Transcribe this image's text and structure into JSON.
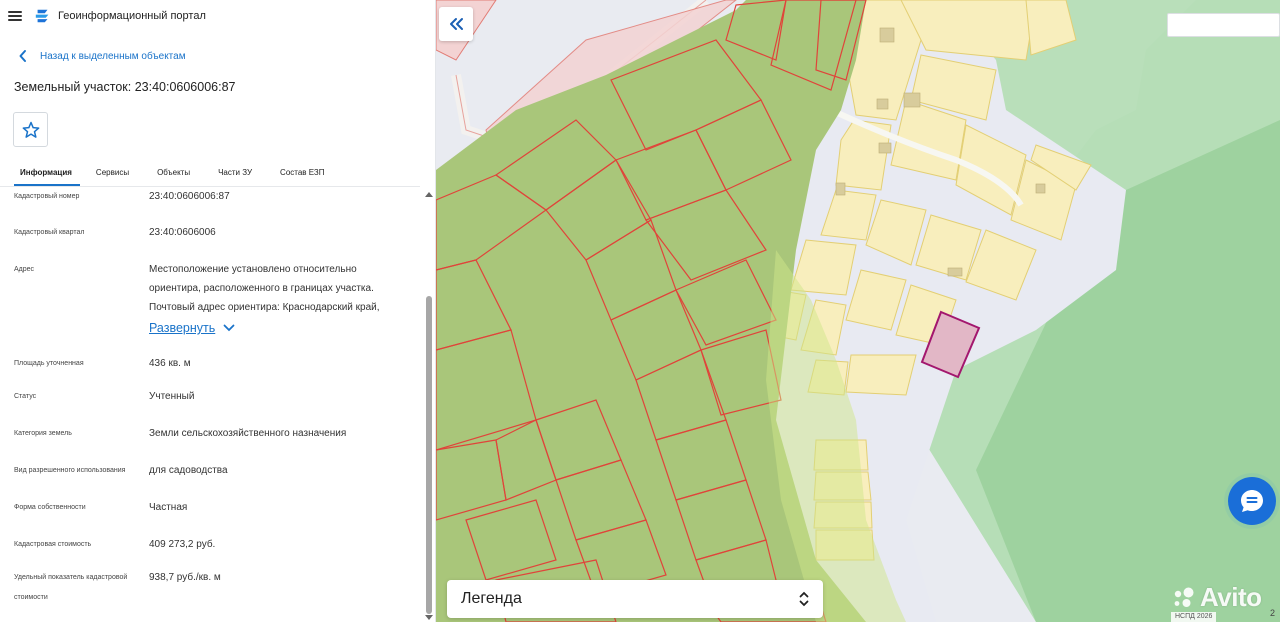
{
  "app": {
    "title": "Геоинформационный портал"
  },
  "panel": {
    "back_label": "Назад к выделенным объектам",
    "object_title": "Земельный участок: 23:40:0606006:87",
    "tabs": [
      {
        "label": "Информация",
        "active": true
      },
      {
        "label": "Сервисы"
      },
      {
        "label": "Объекты"
      },
      {
        "label": "Части ЗУ"
      },
      {
        "label": "Состав ЕЗП"
      }
    ],
    "attributes": [
      {
        "label": "Кадастровый номер",
        "value": "23:40:0606006:87"
      },
      {
        "label": "Кадастровый квартал",
        "value": "23:40:0606006"
      },
      {
        "label": "Адрес",
        "value": "Местоположение установлено относительно ориентира, расположенного в границах участка. Почтовый адрес ориентира: Краснодарский край, г.Геленджик, снт"
      },
      {
        "label": "Площадь уточненная",
        "value": "436 кв. м"
      },
      {
        "label": "Статус",
        "value": "Учтенный"
      },
      {
        "label": "Категория земель",
        "value": "Земли сельскохозяйственного назначения"
      },
      {
        "label": "Вид разрешенного использования",
        "value": "для садоводства"
      },
      {
        "label": "Форма собственности",
        "value": "Частная"
      },
      {
        "label": "Кадастровая стоимость",
        "value": "409 273,2 руб."
      },
      {
        "label": "Удельный показатель кадастровой стоимости",
        "value": "938,7 руб./кв. м"
      }
    ],
    "expand_label": "Развернуть"
  },
  "map": {
    "legend_label": "Легенда",
    "attribution": "НСПД 2026",
    "zoom_hint": "2",
    "watermark": "Avito",
    "colors": {
      "agri_fill": "#a9c67a",
      "agri_border": "#e0443a",
      "garden_fill": "#f8eebd",
      "garden_border": "#e3cf74",
      "forest_fill": "#b9dfba",
      "forest_dark": "#8bc98d",
      "selected_fill": "#e2b7c6",
      "selected_border": "#a3176e"
    }
  }
}
